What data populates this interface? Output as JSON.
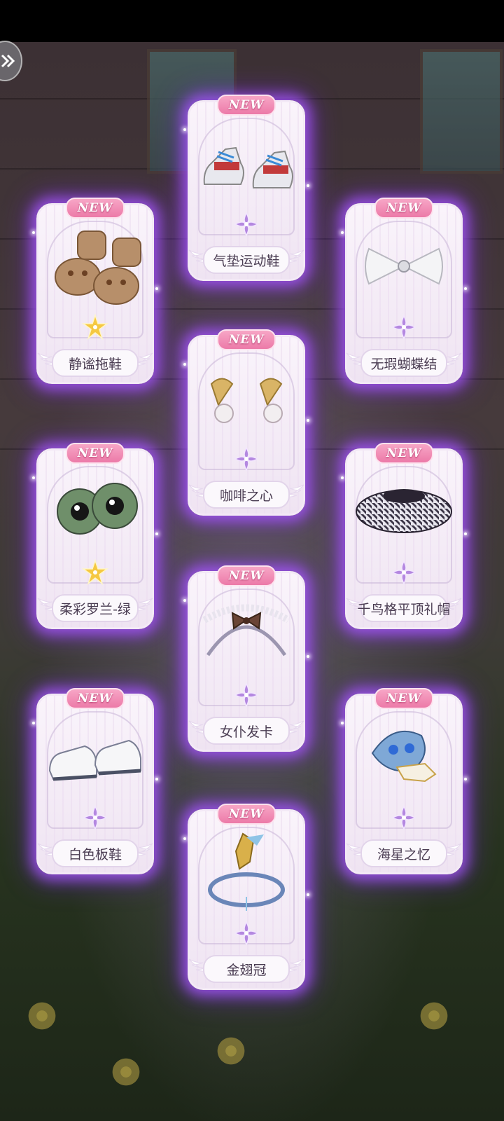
{
  "new_badge": "NEW",
  "colors": {
    "card_glow": "#aa5aff",
    "badge": "#ec7aa8",
    "rarity_purple": "#b488e0",
    "rarity_gold": "#f5c842",
    "name_text": "#4a3c52"
  },
  "items": [
    {
      "name": "气垫运动鞋",
      "rarity_icon": "purple-flower-icon"
    },
    {
      "name": "静谧拖鞋",
      "rarity_icon": "gold-star-flower-icon"
    },
    {
      "name": "无瑕蝴蝶结",
      "rarity_icon": "purple-flower-icon"
    },
    {
      "name": "咖啡之心",
      "rarity_icon": "purple-flower-icon"
    },
    {
      "name": "柔彩罗兰-绿",
      "rarity_icon": "gold-star-flower-icon"
    },
    {
      "name": "千鸟格平顶礼帽",
      "rarity_icon": "purple-flower-icon"
    },
    {
      "name": "女仆发卡",
      "rarity_icon": "purple-flower-icon"
    },
    {
      "name": "白色板鞋",
      "rarity_icon": "purple-flower-icon"
    },
    {
      "name": "海星之忆",
      "rarity_icon": "purple-flower-icon"
    },
    {
      "name": "金翅冠",
      "rarity_icon": "purple-flower-icon"
    }
  ]
}
